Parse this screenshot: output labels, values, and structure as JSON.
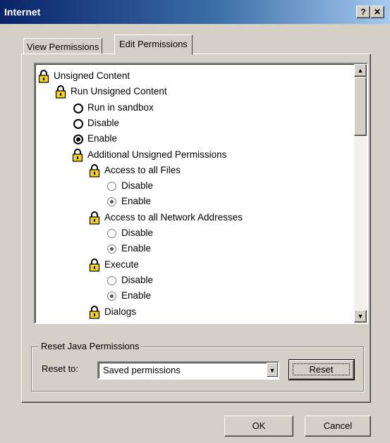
{
  "window": {
    "title": "Internet",
    "help_label": "?",
    "close_label": "✕"
  },
  "tabs": [
    {
      "label": "View Permissions",
      "selected": false
    },
    {
      "label": "Edit Permissions",
      "selected": true
    }
  ],
  "tree": {
    "items": [
      {
        "label": "Unsigned Content",
        "kind": "lock",
        "level": 0
      },
      {
        "label": "Run Unsigned Content",
        "kind": "lock",
        "level": 1
      },
      {
        "label": "Run in sandbox",
        "kind": "radio",
        "level": 2,
        "checked": false,
        "enabled": true
      },
      {
        "label": "Disable",
        "kind": "radio",
        "level": 2,
        "checked": false,
        "enabled": true
      },
      {
        "label": "Enable",
        "kind": "radio",
        "level": 2,
        "checked": true,
        "enabled": true
      },
      {
        "label": "Additional Unsigned Permissions",
        "kind": "lock",
        "level": 2
      },
      {
        "label": "Access to all Files",
        "kind": "lock",
        "level": 3
      },
      {
        "label": "Disable",
        "kind": "radio",
        "level": 4,
        "checked": false,
        "enabled": false
      },
      {
        "label": "Enable",
        "kind": "radio",
        "level": 4,
        "checked": true,
        "enabled": false
      },
      {
        "label": "Access to all Network Addresses",
        "kind": "lock",
        "level": 3
      },
      {
        "label": "Disable",
        "kind": "radio",
        "level": 4,
        "checked": false,
        "enabled": false
      },
      {
        "label": "Enable",
        "kind": "radio",
        "level": 4,
        "checked": true,
        "enabled": false
      },
      {
        "label": "Execute",
        "kind": "lock",
        "level": 3
      },
      {
        "label": "Disable",
        "kind": "radio",
        "level": 4,
        "checked": false,
        "enabled": false
      },
      {
        "label": "Enable",
        "kind": "radio",
        "level": 4,
        "checked": true,
        "enabled": false
      },
      {
        "label": "Dialogs",
        "kind": "lock",
        "level": 3
      }
    ]
  },
  "reset_group": {
    "legend": "Reset Java Permissions",
    "reset_to_label": "Reset to:",
    "selected_option": "Saved permissions",
    "reset_button_label": "Reset"
  },
  "buttons": {
    "ok_label": "OK",
    "cancel_label": "Cancel"
  },
  "colors": {
    "title_gradient_start": "#0a246a",
    "title_gradient_end": "#a6caf0",
    "face": "#d4d0c8",
    "lock_body": "#f2d21b"
  }
}
